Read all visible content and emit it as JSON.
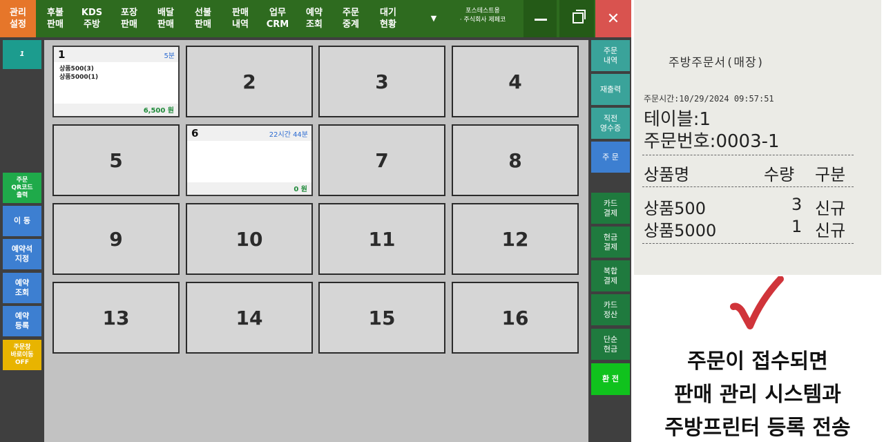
{
  "topbar": {
    "menu": [
      {
        "label1": "관리",
        "label2": "설정"
      },
      {
        "label1": "후불",
        "label2": "판매"
      },
      {
        "label1": "KDS",
        "label2": "주방"
      },
      {
        "label1": "포장",
        "label2": "판매"
      },
      {
        "label1": "배달",
        "label2": "판매"
      },
      {
        "label1": "선불",
        "label2": "판매"
      },
      {
        "label1": "판매",
        "label2": "내역"
      },
      {
        "label1": "업무",
        "label2": "CRM"
      },
      {
        "label1": "예약",
        "label2": "조회"
      },
      {
        "label1": "주문",
        "label2": "중계"
      },
      {
        "label1": "대기",
        "label2": "현황"
      }
    ],
    "store_line1": "포스테스트용",
    "store_line2": "· 주식회사 제페코",
    "dropdown_icon": "▼",
    "close_glyph": "✕"
  },
  "left_sidebar": {
    "page_label": "1",
    "buttons": [
      {
        "line1": "주문",
        "line2": "QR코드",
        "line3": "출력"
      },
      {
        "line1": "이 동"
      },
      {
        "line1": "예약석",
        "line2": "지정"
      },
      {
        "line1": "예약",
        "line2": "조회"
      },
      {
        "line1": "예약",
        "line2": "등록"
      },
      {
        "line1": "주문창",
        "line2": "바로이동",
        "line3": "OFF"
      }
    ]
  },
  "tables": [
    {
      "number": "1",
      "elapsed": "5분",
      "items": [
        "상품500(3)",
        "상품5000(1)"
      ],
      "amount": "6,500 원"
    },
    {
      "number": "2"
    },
    {
      "number": "3"
    },
    {
      "number": "4"
    },
    {
      "number": "5"
    },
    {
      "number": "6",
      "elapsed": "22시간 44분",
      "items": [],
      "amount": "0 원"
    },
    {
      "number": "7"
    },
    {
      "number": "8"
    },
    {
      "number": "9"
    },
    {
      "number": "10"
    },
    {
      "number": "11"
    },
    {
      "number": "12"
    },
    {
      "number": "13"
    },
    {
      "number": "14"
    },
    {
      "number": "15"
    },
    {
      "number": "16"
    }
  ],
  "right_sidebar": {
    "buttons": [
      {
        "line1": "주문",
        "line2": "내역"
      },
      {
        "line1": "재출력"
      },
      {
        "line1": "직전",
        "line2": "영수증"
      },
      {
        "line1": "주 문"
      },
      {
        "line1": "카드",
        "line2": "결제"
      },
      {
        "line1": "현금",
        "line2": "결제"
      },
      {
        "line1": "복합",
        "line2": "결제"
      },
      {
        "line1": "카드",
        "line2": "정산"
      },
      {
        "line1": "단순",
        "line2": "현금"
      },
      {
        "line1": "환 전"
      }
    ]
  },
  "receipt": {
    "title": "주방주문서(매장)",
    "order_time": "주문시간:10/29/2024 09:57:51",
    "table": "테이블:1",
    "order_no": "주문번호:0003-1",
    "col_name": "상품명",
    "col_qty": "수량",
    "col_type": "구분",
    "lines": [
      {
        "name": "상품500",
        "qty": "3",
        "type": "신규"
      },
      {
        "name": "상품5000",
        "qty": "1",
        "type": "신규"
      }
    ]
  },
  "caption": {
    "line1": "주문이 접수되면",
    "line2": "판매 관리 시스템과",
    "line3": "주방프린터 등록 전송"
  },
  "colors": {
    "topbar": "#2e6b1f",
    "active_menu": "#e6762a",
    "close": "#d9534f",
    "check": "#d0343a"
  }
}
